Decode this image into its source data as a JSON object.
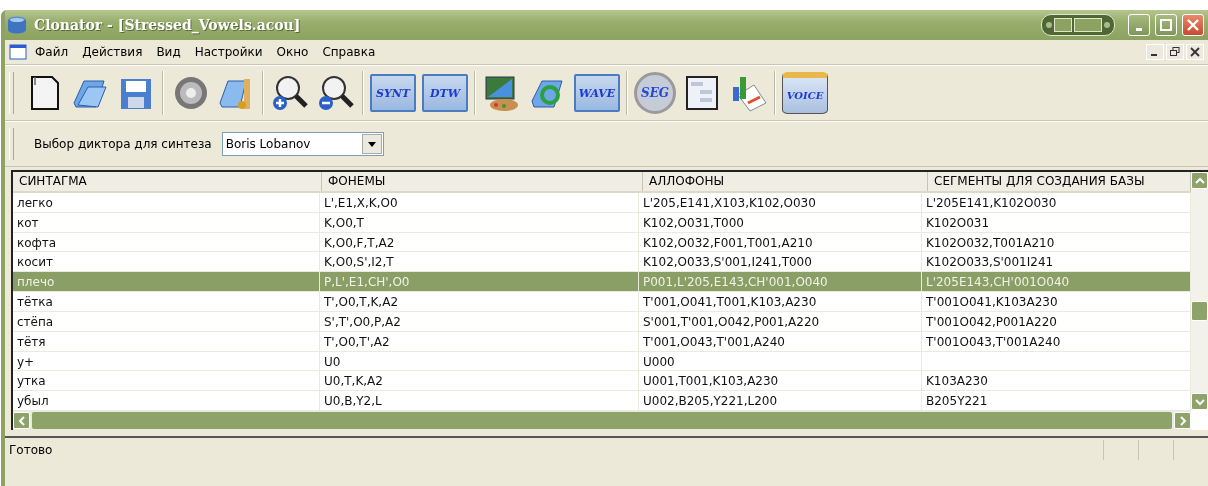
{
  "window": {
    "title": "Clonator - [Stressed_Vowels.acou]"
  },
  "menu": [
    "Файл",
    "Действия",
    "Вид",
    "Настройки",
    "Окно",
    "Справка"
  ],
  "toolbar": [
    {
      "kind": "new"
    },
    {
      "kind": "open"
    },
    {
      "kind": "save"
    },
    {
      "kind": "sep"
    },
    {
      "kind": "speaker"
    },
    {
      "kind": "music"
    },
    {
      "kind": "sep"
    },
    {
      "kind": "zoomin"
    },
    {
      "kind": "zoomout"
    },
    {
      "kind": "sep"
    },
    {
      "kind": "label",
      "label": "SYNT"
    },
    {
      "kind": "label",
      "label": "DTW"
    },
    {
      "kind": "sep"
    },
    {
      "kind": "paint"
    },
    {
      "kind": "refresh"
    },
    {
      "kind": "label",
      "label": "WAVE"
    },
    {
      "kind": "sep"
    },
    {
      "kind": "seg",
      "label": "SEG"
    },
    {
      "kind": "list"
    },
    {
      "kind": "chart"
    },
    {
      "kind": "sep"
    },
    {
      "kind": "voice",
      "label": "VOICE"
    }
  ],
  "speaker_select": {
    "label": "Выбор диктора для синтеза",
    "value": "Boris Lobanov"
  },
  "table": {
    "columns": [
      "СИНТАГМА",
      "ФОНЕМЫ",
      "АЛЛОФОНЫ",
      "СЕГМЕНТЫ ДЛЯ СОЗДАНИЯ БАЗЫ"
    ],
    "rows": [
      {
        "cells": [
          "легко",
          "L',E1,X,K,O0",
          "L'205,E141,X103,K102,O030",
          "L'205E141,K102O030"
        ],
        "selected": false
      },
      {
        "cells": [
          "кот",
          "K,O0,T",
          "K102,O031,T000",
          "K102O031"
        ],
        "selected": false
      },
      {
        "cells": [
          "кофта",
          "K,O0,F,T,A2",
          "K102,O032,F001,T001,A210",
          "K102O032,T001A210"
        ],
        "selected": false
      },
      {
        "cells": [
          "косит",
          "K,O0,S',I2,T",
          "K102,O033,S'001,I241,T000",
          "K102O033,S'001I241"
        ],
        "selected": false
      },
      {
        "cells": [
          "плечо",
          "P,L',E1,CH',O0",
          "P001,L'205,E143,CH'001,O040",
          "L'205E143,CH'001O040"
        ],
        "selected": true
      },
      {
        "cells": [
          "тётка",
          "T',O0,T,K,A2",
          "T'001,O041,T001,K103,A230",
          "T'001O041,K103A230"
        ],
        "selected": false
      },
      {
        "cells": [
          "стёпа",
          "S',T',O0,P,A2",
          "S'001,T'001,O042,P001,A220",
          "T'001O042,P001A220"
        ],
        "selected": false
      },
      {
        "cells": [
          "тётя",
          "T',O0,T',A2",
          "T'001,O043,T'001,A240",
          "T'001O043,T'001A240"
        ],
        "selected": false
      },
      {
        "cells": [
          "у+",
          "U0",
          "U000",
          ""
        ],
        "selected": false
      },
      {
        "cells": [
          "утка",
          "U0,T,K,A2",
          "U001,T001,K103,A230",
          "K103A230"
        ],
        "selected": false
      },
      {
        "cells": [
          "убыл",
          "U0,B,Y2,L",
          "U002,B205,Y221,L200",
          "B205Y221"
        ],
        "selected": false
      }
    ]
  },
  "status_bar": {
    "text": "Готово"
  }
}
